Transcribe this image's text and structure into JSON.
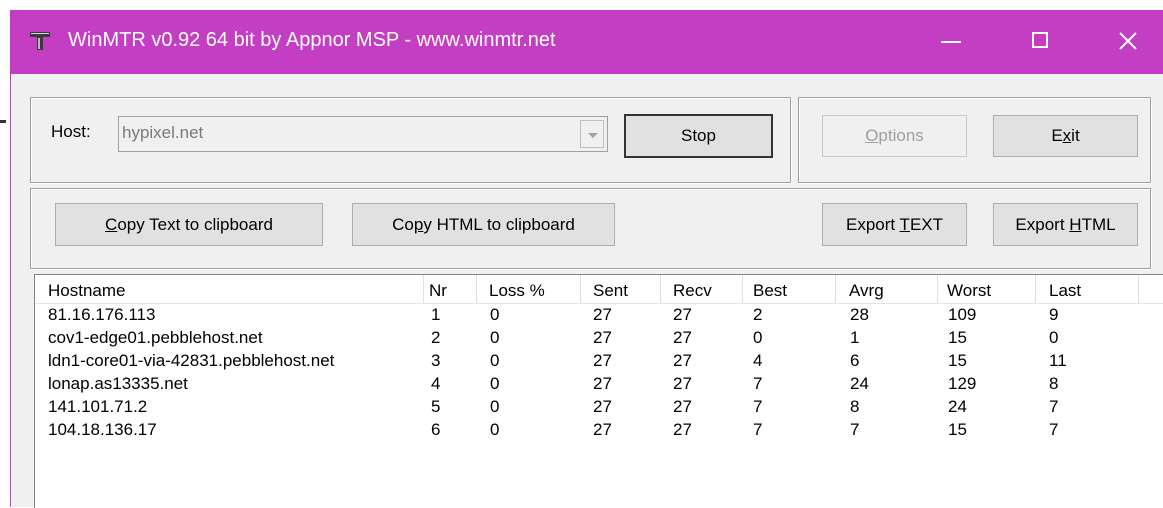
{
  "window": {
    "title": "WinMTR v0.92 64 bit by Appnor MSP - www.winmtr.net",
    "accent_color": "#c43ec4",
    "icons": [
      "app-icon",
      "minimize-icon",
      "maximize-icon",
      "close-icon"
    ]
  },
  "host": {
    "label": "Host:",
    "value": "hypixel.net",
    "placeholder": ""
  },
  "buttons": {
    "stop": "Stop",
    "options": "Options",
    "exit": "Exit",
    "copy_text": "Copy Text to clipboard",
    "copy_html": "Copy HTML to clipboard",
    "export_text": "Export TEXT",
    "export_html": "Export HTML"
  },
  "table": {
    "columns": [
      "Hostname",
      "Nr",
      "Loss %",
      "Sent",
      "Recv",
      "Best",
      "Avrg",
      "Worst",
      "Last"
    ],
    "rows": [
      [
        "81.16.176.113",
        "1",
        "0",
        "27",
        "27",
        "2",
        "28",
        "109",
        "9"
      ],
      [
        "cov1-edge01.pebblehost.net",
        "2",
        "0",
        "27",
        "27",
        "0",
        "1",
        "15",
        "0"
      ],
      [
        "ldn1-core01-via-42831.pebblehost.net",
        "3",
        "0",
        "27",
        "27",
        "4",
        "6",
        "15",
        "11"
      ],
      [
        "lonap.as13335.net",
        "4",
        "0",
        "27",
        "27",
        "7",
        "24",
        "129",
        "8"
      ],
      [
        "141.101.71.2",
        "5",
        "0",
        "27",
        "27",
        "7",
        "8",
        "24",
        "7"
      ],
      [
        "104.18.136.17",
        "6",
        "0",
        "27",
        "27",
        "7",
        "7",
        "15",
        "7"
      ]
    ]
  }
}
